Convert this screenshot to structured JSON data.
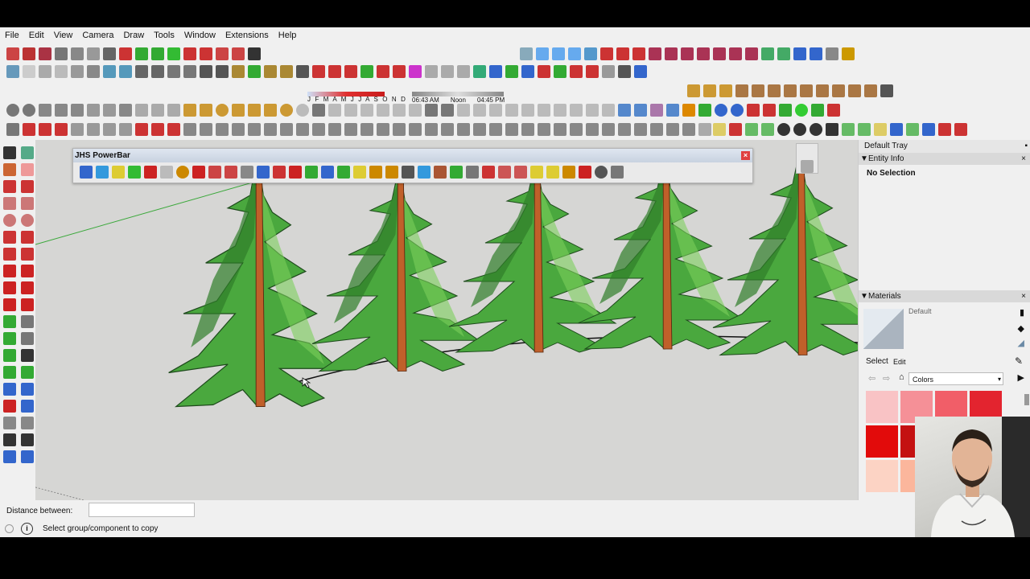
{
  "menu": [
    "File",
    "Edit",
    "View",
    "Camera",
    "Draw",
    "Tools",
    "Window",
    "Extensions",
    "Help"
  ],
  "shadows": {
    "months": "J F M A M J J A S O N D",
    "time_start": "06:43 AM",
    "time_mid": "Noon",
    "time_end": "04:45 PM"
  },
  "powerbar": {
    "title": "JHS PowerBar",
    "close": "×"
  },
  "tray": {
    "title": "Default Tray",
    "entity_info": {
      "header": "Entity Info",
      "selection": "No Selection"
    },
    "materials": {
      "header": "Materials",
      "default_name": "Default",
      "tab_select": "Select",
      "tab_edit": "Edit",
      "library": "Colors"
    },
    "swatches": [
      "#f9c3c5",
      "#f59097",
      "#f15e68",
      "#e3242f",
      "#e20b0b",
      "#c41111",
      "#fcd3c4",
      "#fbb69c",
      "#f25c07",
      "#e04a04"
    ]
  },
  "status": {
    "vcb_label": "Distance between:",
    "vcb_value": "",
    "message": "Select group/component to copy",
    "info_icon": "i"
  },
  "colors": {
    "tree_light": "#5fbf4f",
    "tree_dark": "#1e6a22",
    "trunk": "#c0602a",
    "viewport": "#d6d6d4"
  }
}
